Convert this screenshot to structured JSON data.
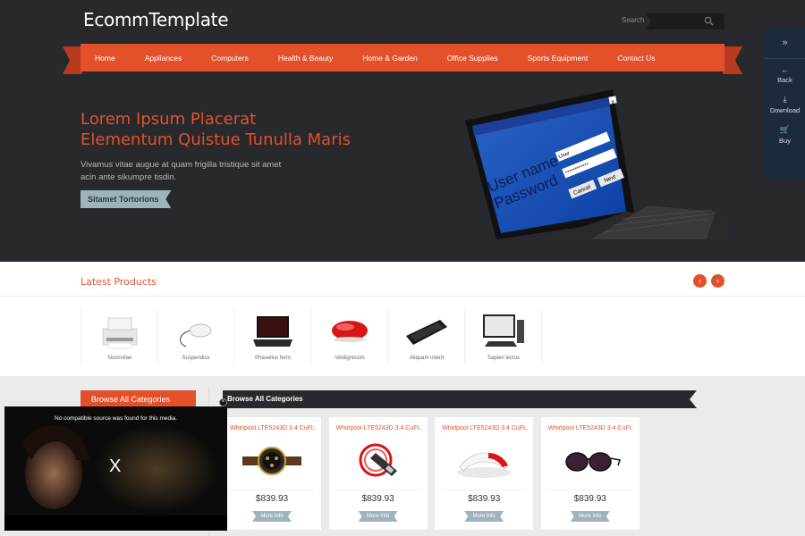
{
  "header": {
    "logo": "EcommTemplate",
    "search_label": "Search",
    "search_icon": "magnifier-icon"
  },
  "nav": {
    "items": [
      "Home",
      "Appliances",
      "Computers",
      "Health & Beauty",
      "Home & Garden",
      "Office Supplies",
      "Sports Equipment",
      "Contact Us"
    ]
  },
  "hero": {
    "title_line1": "Lorem Ipsum Placerat",
    "title_line2": "Elementum Quistue Tunulla Maris",
    "text": "Vivamus vitae augue at quam frigilla tristique sit amet acin ante sikumpre tisdin.",
    "button": "Sitamet Tortorions",
    "screen_user_name": "User name",
    "screen_password": "Password",
    "screen_user_field": "User",
    "screen_password_field": "************",
    "screen_cancel": "Cancel",
    "screen_next": "Next"
  },
  "side_toolbar": {
    "toggle_icon": "double-chevron-right-icon",
    "items": [
      {
        "label": "Back",
        "icon": "arrow-left-icon"
      },
      {
        "label": "Download",
        "icon": "download-icon"
      },
      {
        "label": "Buy",
        "icon": "cart-icon"
      }
    ]
  },
  "latest": {
    "title": "Latest Products",
    "prev_icon": "chevron-left-icon",
    "next_icon": "chevron-right-icon",
    "products": [
      {
        "name": "Nuncvitae",
        "image": "printer"
      },
      {
        "name": "Suspendiss",
        "image": "mouse"
      },
      {
        "name": "Phasellus ferm",
        "image": "laptop"
      },
      {
        "name": "Veldignissim",
        "image": "red-mouse"
      },
      {
        "name": "Aliquam interd",
        "image": "keyboard"
      },
      {
        "name": "Sapien lectus",
        "image": "desktop"
      }
    ]
  },
  "categories": {
    "sidebar_title": "Browse All Categories",
    "bar_title": "Browse All Categories",
    "cards": [
      {
        "title": "Whirlpool LTE5243D 3.4 CuFt....",
        "price": "$839.93",
        "button": "More Info",
        "image": "watch"
      },
      {
        "title": "Whirlpool LTE5243D 3.4 CuFt....",
        "price": "$839.93",
        "button": "More Info",
        "image": "flash-drive"
      },
      {
        "title": "Whirlpool LTE5243D 3.4 CuFt....",
        "price": "$839.93",
        "button": "More Info",
        "image": "stapler"
      },
      {
        "title": "Whirlpool LTE5243D 3.4 CuFt....",
        "price": "$839.93",
        "button": "More Info",
        "image": "sunglasses"
      }
    ]
  },
  "video": {
    "message": "No compatible source was found for this media.",
    "center_mark": "X",
    "close_mark": "×"
  },
  "colors": {
    "accent": "#e3512b",
    "dark": "#27292c",
    "button_grey": "#9fb3bd",
    "side_toolbar": "#1c2a3e"
  }
}
